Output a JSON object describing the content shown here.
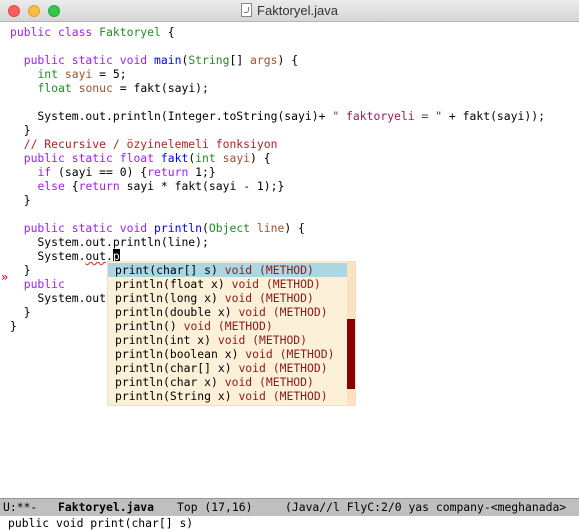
{
  "window": {
    "title": "Faktoryel.java",
    "file_icon": "java-file-icon"
  },
  "code": {
    "l1": {
      "a": "public class ",
      "b": "Faktoryel",
      "c": " {"
    },
    "l3": {
      "a": "  public static void ",
      "b": "main",
      "c": "(",
      "d": "String",
      "e": "[] ",
      "f": "args",
      "g": ") {"
    },
    "l4": {
      "a": "    ",
      "b": "int",
      "c": " ",
      "d": "sayi",
      "e": " = 5;"
    },
    "l5": {
      "a": "    ",
      "b": "float",
      "c": " ",
      "d": "sonuc",
      "e": " = fakt(sayi);"
    },
    "l7": {
      "a": "    System.out.println(Integer.toString(sayi)+ ",
      "b": "\" faktoryeli = \"",
      "c": " + fakt(sayi));"
    },
    "l8": "  }",
    "l9": "  // Recursive / özyinelemeli fonksiyon",
    "l10": {
      "a": "  public static float ",
      "b": "fakt",
      "c": "(",
      "d": "int",
      "e": " ",
      "f": "sayi",
      "g": ") {"
    },
    "l11": {
      "a": "    ",
      "b": "if",
      "c": " (sayi == 0) {",
      "d": "return",
      "e": " 1;}"
    },
    "l12": {
      "a": "    ",
      "b": "else",
      "c": " {",
      "d": "return",
      "e": " sayi * fakt(sayi - 1);}"
    },
    "l13": "  }",
    "l15": {
      "a": "  public static void ",
      "b": "println",
      "c": "(",
      "d": "Object",
      "e": " ",
      "f": "line",
      "g": ") {"
    },
    "l16": "    System.out.println(line);",
    "l17": {
      "a": "    System.",
      "b": "out",
      "c": ".",
      "d": "p"
    },
    "l18": "  }",
    "l19": {
      "a": "  public",
      "b": "  "
    },
    "l20": "    System.out",
    "l21": "  }",
    "l22": "}"
  },
  "fringe": {
    "error_marker": "»"
  },
  "completion": {
    "items": [
      {
        "name": "print(char[] s)",
        "type": " void (METHOD)"
      },
      {
        "name": "println(float x)",
        "type": " void (METHOD)"
      },
      {
        "name": "println(long x)",
        "type": " void (METHOD)"
      },
      {
        "name": "println(double x)",
        "type": " void (METHOD)"
      },
      {
        "name": "println()",
        "type": " void (METHOD)"
      },
      {
        "name": "println(int x)",
        "type": " void (METHOD)"
      },
      {
        "name": "println(boolean x)",
        "type": " void (METHOD)"
      },
      {
        "name": "println(char[] x)",
        "type": " void (METHOD)"
      },
      {
        "name": "println(char x)",
        "type": " void (METHOD)"
      },
      {
        "name": "println(String x)",
        "type": " void (METHOD)"
      }
    ],
    "selected_index": 0
  },
  "modeline": {
    "status": "U:**-",
    "buffer": "Faktoryel.java",
    "position": "Top (17,16)",
    "modes": "(Java//l FlyC:2/0 yas company-<meghanada>"
  },
  "minibuffer": {
    "text": "public void print(char[] s)"
  },
  "colors": {
    "keyword": "#a020f0",
    "type": "#228b22",
    "function": "#0000ff",
    "variable": "#a0522d",
    "string": "#8b2252",
    "comment": "#b22222",
    "popup_bg": "#fdf0d8",
    "popup_selection": "#abd6e4",
    "modeline_bg": "#bfbfbf"
  }
}
